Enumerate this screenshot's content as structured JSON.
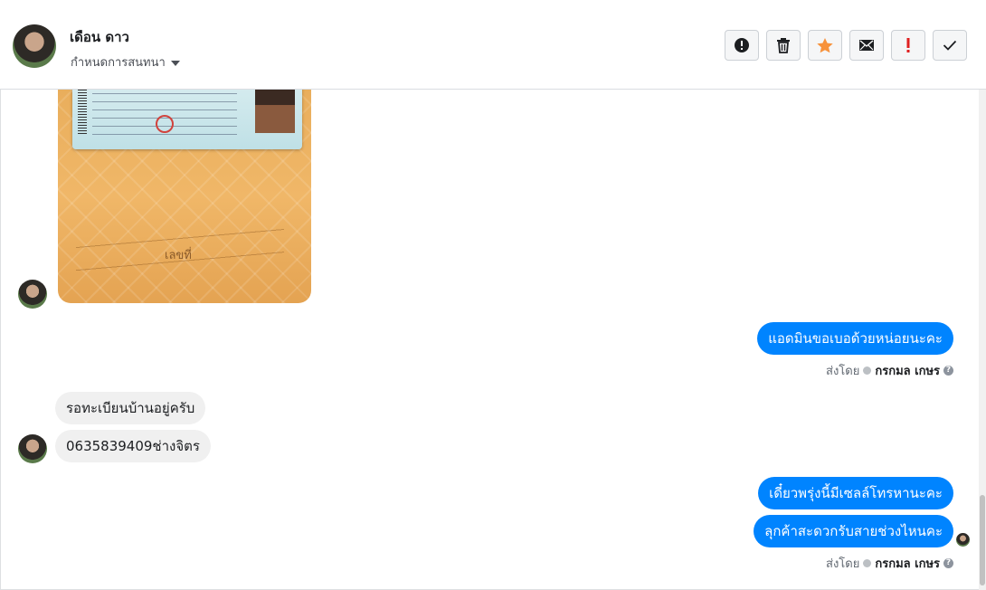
{
  "header": {
    "contact_name": "เดือน ดาว",
    "assign_label": "กำหนดการสนทนา"
  },
  "toolbar": {
    "buttons": [
      {
        "name": "report",
        "icon": "exclamation-circle-icon"
      },
      {
        "name": "delete",
        "icon": "trash-icon"
      },
      {
        "name": "star",
        "icon": "star-icon",
        "color": "#f7923b"
      },
      {
        "name": "mail",
        "icon": "envelope-icon"
      },
      {
        "name": "important",
        "icon": "exclamation-icon",
        "color": "#e02020"
      },
      {
        "name": "done",
        "icon": "checkmark-icon"
      }
    ]
  },
  "messages": {
    "photo_caption": "เลขที่",
    "out_1": "แอดมินขอเบอด้วยหน่อยนะคะ",
    "in_1": "รอทะเบียนบ้านอยู่ครับ",
    "in_2": "0635839409ช่างจิตร",
    "out_2": "เดี๋ยวพรุ่งนี้มีเซลล์โทรหานะคะ",
    "out_3": "ลุกค้าสะดวกรับสายช่วงไหนคะ",
    "sent_by_label": "ส่งโดย",
    "sender_name": "กรกมล เกษร"
  },
  "colors": {
    "outgoing_bubble": "#0084ff",
    "incoming_bubble": "#f0f0f0"
  }
}
